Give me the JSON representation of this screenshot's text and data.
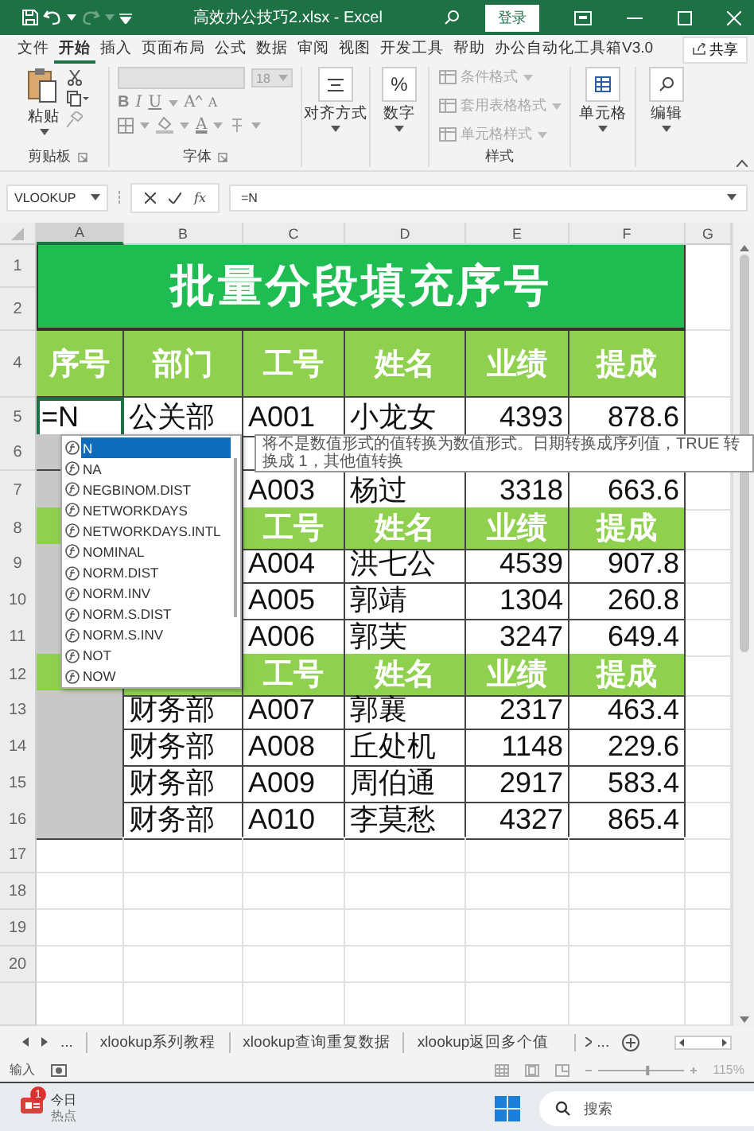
{
  "window": {
    "title": "高效办公技巧2.xlsx  -  Excel",
    "sign_in": "登录",
    "redo": {
      "disabled": true
    }
  },
  "menu": {
    "tabs": [
      {
        "label": "文件",
        "selected": false
      },
      {
        "label": "开始",
        "selected": true
      },
      {
        "label": "插入",
        "selected": false
      },
      {
        "label": "页面布局",
        "selected": false
      },
      {
        "label": "公式",
        "selected": false
      },
      {
        "label": "数据",
        "selected": false
      },
      {
        "label": "审阅",
        "selected": false
      },
      {
        "label": "视图",
        "selected": false
      },
      {
        "label": "开发工具",
        "selected": false
      },
      {
        "label": "帮助",
        "selected": false
      },
      {
        "label": "办公自动化工具箱V3.0",
        "selected": false
      }
    ],
    "share": "共享"
  },
  "ribbon": {
    "clipboard": {
      "paste": "粘贴",
      "label": "剪贴板"
    },
    "font": {
      "size": "18",
      "buttons": [
        {
          "kind": "bold",
          "label": "B"
        },
        {
          "kind": "italic",
          "label": "I"
        },
        {
          "kind": "underline",
          "label": "U"
        }
      ],
      "grow": "A",
      "shrink": "A",
      "font_color": "A",
      "label": "字体"
    },
    "alignment": "对齐方式",
    "number": {
      "symbol": "%",
      "label": "数字"
    },
    "styles": {
      "items": [
        {
          "label": "条件格式",
          "disabled": true
        },
        {
          "label": "套用表格格式",
          "disabled": true
        },
        {
          "label": "单元格样式",
          "disabled": true
        }
      ],
      "label": "样式"
    },
    "cells": "单元格",
    "editing": "编辑"
  },
  "formula_bar": {
    "name_box": "VLOOKUP",
    "function_button": "fx",
    "formula": "=N"
  },
  "sheet": {
    "columns": [
      {
        "label": "A",
        "selected": true
      },
      {
        "label": "B",
        "selected": false
      },
      {
        "label": "C",
        "selected": false
      },
      {
        "label": "D",
        "selected": false
      },
      {
        "label": "E",
        "selected": false
      },
      {
        "label": "F",
        "selected": false
      },
      {
        "label": "G",
        "selected": false
      }
    ],
    "title_rows": [
      "1",
      "2"
    ],
    "title": "批量分段填充序号",
    "rows": [
      {
        "num": "4",
        "kind": "header",
        "cells": [
          "序号",
          "部门",
          "工号",
          "姓名",
          "业绩",
          "提成"
        ]
      },
      {
        "num": "5",
        "kind": "data",
        "active": true,
        "selected": false,
        "cells": [
          "=N",
          "公关部",
          "A001",
          "小龙女",
          "4393",
          "878.6"
        ]
      },
      {
        "num": "6",
        "kind": "data",
        "active": false,
        "selected": true,
        "cells": [
          null,
          null,
          null,
          null,
          null,
          null
        ]
      },
      {
        "num": "7",
        "kind": "data",
        "active": false,
        "selected": true,
        "cells": [
          null,
          null,
          "A003",
          "杨过",
          "3318",
          "663.6"
        ]
      },
      {
        "num": "8",
        "kind": "header",
        "cells": [
          null,
          null,
          "工号",
          "姓名",
          "业绩",
          "提成"
        ]
      },
      {
        "num": "9",
        "kind": "data",
        "active": false,
        "selected": true,
        "cells": [
          null,
          null,
          "A004",
          "洪七公",
          "4539",
          "907.8"
        ]
      },
      {
        "num": "10",
        "kind": "data",
        "active": false,
        "selected": true,
        "cells": [
          null,
          null,
          "A005",
          "郭靖",
          "1304",
          "260.8"
        ]
      },
      {
        "num": "11",
        "kind": "data",
        "active": false,
        "selected": true,
        "cells": [
          null,
          null,
          "A006",
          "郭芙",
          "3247",
          "649.4"
        ]
      },
      {
        "num": "12",
        "kind": "header",
        "cells": [
          null,
          null,
          "工号",
          "姓名",
          "业绩",
          "提成"
        ]
      },
      {
        "num": "13",
        "kind": "data",
        "active": false,
        "selected": true,
        "cells": [
          null,
          "财务部",
          "A007",
          "郭襄",
          "2317",
          "463.4"
        ]
      },
      {
        "num": "14",
        "kind": "data",
        "active": false,
        "selected": true,
        "cells": [
          null,
          "财务部",
          "A008",
          "丘处机",
          "1148",
          "229.6"
        ]
      },
      {
        "num": "15",
        "kind": "data",
        "active": false,
        "selected": true,
        "cells": [
          null,
          "财务部",
          "A009",
          "周伯通",
          "2917",
          "583.4"
        ]
      },
      {
        "num": "16",
        "kind": "data",
        "active": false,
        "selected": true,
        "cells": [
          null,
          "财务部",
          "A010",
          "李莫愁",
          "4327",
          "865.4"
        ]
      },
      {
        "num": "17",
        "kind": "empty"
      },
      {
        "num": "18",
        "kind": "empty"
      },
      {
        "num": "19",
        "kind": "empty"
      },
      {
        "num": "20",
        "kind": "empty"
      }
    ],
    "autocomplete": {
      "items": [
        {
          "label": "N",
          "selected": true
        },
        {
          "label": "NA",
          "selected": false
        },
        {
          "label": "NEGBINOM.DIST",
          "selected": false
        },
        {
          "label": "NETWORKDAYS",
          "selected": false
        },
        {
          "label": "NETWORKDAYS.INTL",
          "selected": false
        },
        {
          "label": "NOMINAL",
          "selected": false
        },
        {
          "label": "NORM.DIST",
          "selected": false
        },
        {
          "label": "NORM.INV",
          "selected": false
        },
        {
          "label": "NORM.S.DIST",
          "selected": false
        },
        {
          "label": "NORM.S.INV",
          "selected": false
        },
        {
          "label": "NOT",
          "selected": false
        },
        {
          "label": "NOW",
          "selected": false
        }
      ],
      "tooltip": "将不是数值形式的值转换为数值形式。日期转换成序列值，TRUE 转换成 1，其他值转换"
    }
  },
  "sheet_tabs": {
    "overflow_left": "...",
    "tabs": [
      {
        "label": "xlookup系列教程",
        "selected": false
      },
      {
        "label": "xlookup查询重复数据",
        "selected": false
      },
      {
        "label": "xlookup返回多个值",
        "selected": false
      }
    ],
    "overflow_right": "..."
  },
  "status_bar": {
    "mode": "输入",
    "zoom_slider": {
      "level": 0.58
    },
    "zoom": "115%"
  },
  "taskbar": {
    "widget": {
      "badge": "1",
      "title": "今日",
      "subtitle": "热点"
    },
    "search": {
      "placeholder": "搜索"
    }
  }
}
